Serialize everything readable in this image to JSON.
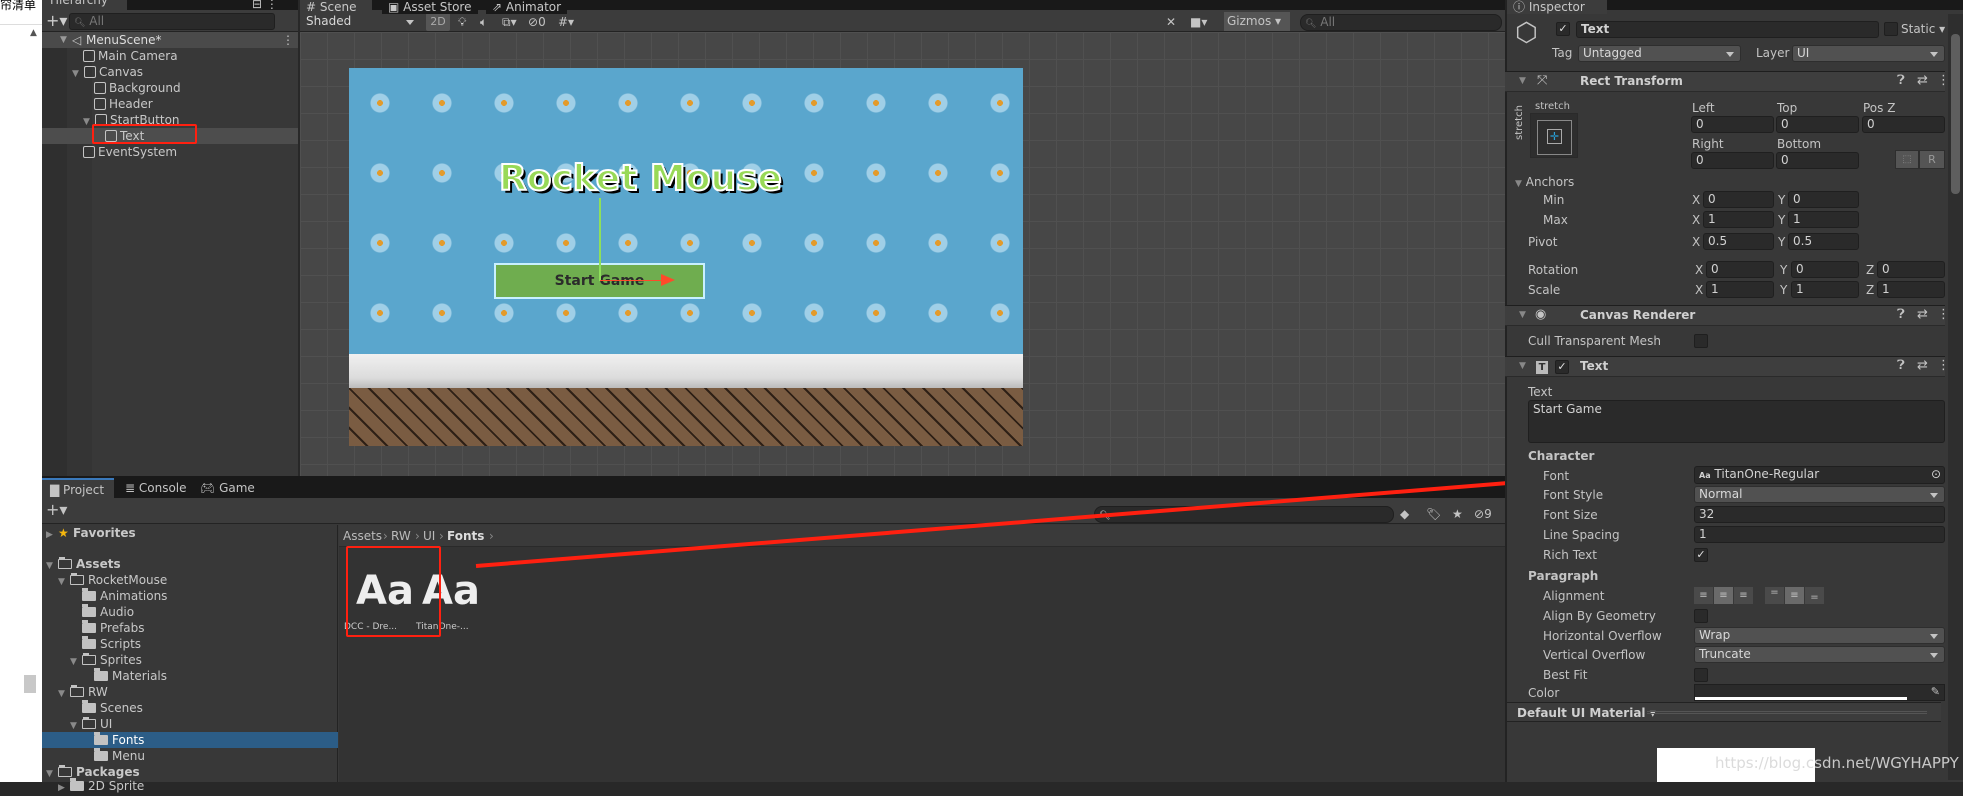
{
  "left_strip": {
    "text": "帘清单"
  },
  "hierarchy": {
    "tab": "Hierarchy",
    "search_placeholder": "All",
    "scene": "MenuScene*",
    "items": [
      {
        "label": "Main Camera",
        "depth": 1
      },
      {
        "label": "Canvas",
        "depth": 1,
        "expanded": true
      },
      {
        "label": "Background",
        "depth": 2
      },
      {
        "label": "Header",
        "depth": 2
      },
      {
        "label": "StartButton",
        "depth": 2,
        "expanded": true
      },
      {
        "label": "Text",
        "depth": 3,
        "selected": true
      },
      {
        "label": "EventSystem",
        "depth": 1
      }
    ]
  },
  "scene_view": {
    "tabs": [
      "Scene",
      "Asset Store",
      "Animator"
    ],
    "shading": "Shaded",
    "mode_2d": "2D",
    "hidden_count": "0",
    "gizmos": "Gizmos",
    "search_placeholder": "All",
    "game": {
      "title": "Rocket Mouse",
      "button": "Start Game"
    }
  },
  "project": {
    "tabs": [
      "Project",
      "Console",
      "Game"
    ],
    "hidden_count": "9",
    "tree": [
      {
        "label": "Favorites",
        "depth": 0,
        "icon": "star-icon"
      },
      {
        "label": "Assets",
        "depth": 0,
        "icon": "folder-open-icon"
      },
      {
        "label": "RocketMouse",
        "depth": 1,
        "icon": "folder-open-icon"
      },
      {
        "label": "Animations",
        "depth": 2,
        "icon": "folder-icon"
      },
      {
        "label": "Audio",
        "depth": 2,
        "icon": "folder-icon"
      },
      {
        "label": "Prefabs",
        "depth": 2,
        "icon": "folder-icon"
      },
      {
        "label": "Scripts",
        "depth": 2,
        "icon": "folder-icon"
      },
      {
        "label": "Sprites",
        "depth": 2,
        "icon": "folder-open-icon"
      },
      {
        "label": "Materials",
        "depth": 3,
        "icon": "folder-icon"
      },
      {
        "label": "RW",
        "depth": 1,
        "icon": "folder-open-icon"
      },
      {
        "label": "Scenes",
        "depth": 2,
        "icon": "folder-icon"
      },
      {
        "label": "UI",
        "depth": 2,
        "icon": "folder-open-icon"
      },
      {
        "label": "Fonts",
        "depth": 3,
        "icon": "folder-icon",
        "selected": true
      },
      {
        "label": "Menu",
        "depth": 3,
        "icon": "folder-icon"
      },
      {
        "label": "Packages",
        "depth": 0,
        "icon": "folder-open-icon"
      },
      {
        "label": "2D Sprite",
        "depth": 1,
        "icon": "folder-icon"
      }
    ],
    "breadcrumb": [
      "Assets",
      "RW",
      "UI",
      "Fonts"
    ],
    "assets": [
      {
        "glyph": "Aa",
        "label": "DCC - Dre..."
      },
      {
        "glyph": "Aa",
        "label": "TitanOne-..."
      }
    ]
  },
  "inspector": {
    "tab": "Inspector",
    "object_name": "Text",
    "static_label": "Static",
    "tag_label": "Tag",
    "tag": "Untagged",
    "layer_label": "Layer",
    "layer": "UI",
    "rect_transform": {
      "title": "Rect Transform",
      "stretch_h": "stretch",
      "stretch_v": "stretch",
      "left_label": "Left",
      "left": "0",
      "top_label": "Top",
      "top": "0",
      "posz_label": "Pos Z",
      "posz": "0",
      "right_label": "Right",
      "right": "0",
      "bottom_label": "Bottom",
      "bottom": "0",
      "r_button": "R",
      "anchors_label": "Anchors",
      "min_label": "Min",
      "min_x": "0",
      "min_y": "0",
      "max_label": "Max",
      "max_x": "1",
      "max_y": "1",
      "pivot_label": "Pivot",
      "pivot_x": "0.5",
      "pivot_y": "0.5",
      "rotation_label": "Rotation",
      "rot_x": "0",
      "rot_y": "0",
      "rot_z": "0",
      "scale_label": "Scale",
      "scale_x": "1",
      "scale_y": "1",
      "scale_z": "1",
      "x": "X",
      "y": "Y",
      "z": "Z"
    },
    "canvas_renderer": {
      "title": "Canvas Renderer",
      "cull_label": "Cull Transparent Mesh"
    },
    "text": {
      "title": "Text",
      "text_label": "Text",
      "text_value": "Start Game",
      "character_label": "Character",
      "font_label": "Font",
      "font": "TitanOne-Regular",
      "font_prefix": "Aa",
      "font_style_label": "Font Style",
      "font_style": "Normal",
      "font_size_label": "Font Size",
      "font_size": "32",
      "line_spacing_label": "Line Spacing",
      "line_spacing": "1",
      "rich_text_label": "Rich Text",
      "rich_text": true,
      "paragraph_label": "Paragraph",
      "alignment_label": "Alignment",
      "align_geometry_label": "Align By Geometry",
      "h_overflow_label": "Horizontal Overflow",
      "h_overflow": "Wrap",
      "v_overflow_label": "Vertical Overflow",
      "v_overflow": "Truncate",
      "best_fit_label": "Best Fit",
      "color_label": "Color",
      "color": "#ffffff"
    },
    "material": "Default UI Material"
  },
  "watermark": "https://blog.csdn.net/WGYHAPPY",
  "colors": {
    "accent": "#3a79bb",
    "selection": "#2c5d87",
    "annotation": "#ff2010"
  }
}
